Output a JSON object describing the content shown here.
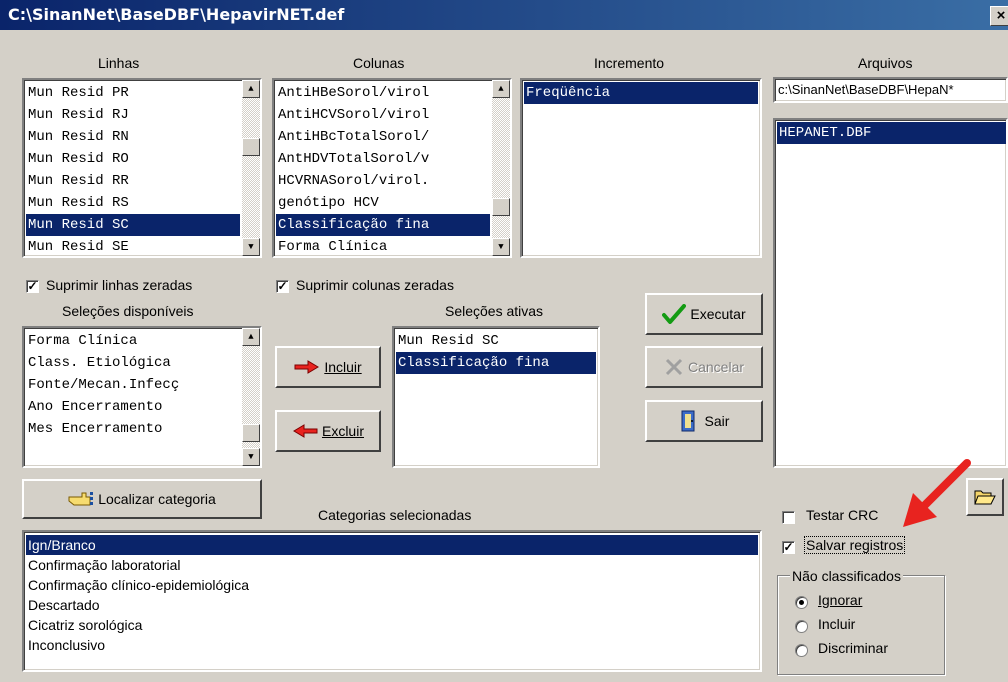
{
  "window": {
    "title": "C:\\SinanNet\\BaseDBF\\HepavirNET.def",
    "close_glyph": "×"
  },
  "labels": {
    "linhas": "Linhas",
    "colunas": "Colunas",
    "incremento": "Incremento",
    "arquivos": "Arquivos",
    "selecoes_disponiveis": "Seleções disponíveis",
    "selecoes_ativas": "Seleções ativas",
    "categorias_selecionadas": "Categorias selecionadas"
  },
  "linhas": {
    "items": [
      "Mun Resid PR",
      "Mun Resid RJ",
      "Mun Resid RN",
      "Mun Resid RO",
      "Mun Resid RR",
      "Mun Resid RS",
      "Mun Resid SC",
      "Mun Resid SE"
    ],
    "selected": "Mun Resid SC"
  },
  "colunas": {
    "items": [
      "AntiHBeSorol/virol",
      "AntiHCVSorol/virol",
      "AntiHBcTotalSorol/",
      "AntHDVTotalSorol/v",
      "HCVRNASorol/virol.",
      "genótipo HCV",
      "Classificação fina",
      "Forma Clínica"
    ],
    "selected": "Classificação fina"
  },
  "incremento": {
    "items": [
      "Freqüência"
    ],
    "selected": "Freqüência"
  },
  "arquivos": {
    "path": "c:\\SinanNet\\BaseDBF\\HepaN*",
    "items": [
      "HEPANET.DBF"
    ],
    "selected": "HEPANET.DBF"
  },
  "checkboxes": {
    "suprimir_linhas": {
      "label": "Suprimir linhas zeradas",
      "checked": true
    },
    "suprimir_colunas": {
      "label": "Suprimir colunas zeradas",
      "checked": true
    },
    "testar_crc": {
      "label": "Testar CRC",
      "checked": false
    },
    "salvar_registros": {
      "label": "Salvar registros",
      "checked": true
    }
  },
  "selecoes_disponiveis": {
    "items": [
      "Forma Clínica",
      "Class. Etiológica",
      "Fonte/Mecan.Infecç",
      "Ano Encerramento",
      "Mes Encerramento"
    ]
  },
  "selecoes_ativas": {
    "items": [
      "Mun Resid SC",
      "Classificação fina"
    ],
    "selected": "Classificação fina"
  },
  "buttons": {
    "incluir": "Incluir",
    "excluir": "Excluir",
    "executar": "Executar",
    "cancelar": "Cancelar",
    "sair": "Sair",
    "localizar": "Localizar categoria"
  },
  "categorias": {
    "items": [
      "Ign/Branco",
      "Confirmação laboratorial",
      "Confirmação clínico-epidemiológica",
      "Descartado",
      "Cicatriz sorológica",
      "Inconclusivo"
    ],
    "selected": "Ign/Branco"
  },
  "nao_classificados": {
    "title": "Não classificados",
    "options": [
      {
        "label": "Ignorar",
        "checked": true
      },
      {
        "label": "Incluir",
        "checked": false
      },
      {
        "label": "Discriminar",
        "checked": false
      }
    ]
  },
  "colors": {
    "selection": "#0a246a",
    "face": "#d4d0c8",
    "arrow_red": "#e8231f"
  },
  "icons": {
    "open_folder": "open-folder-icon",
    "check": "green-check-icon",
    "cancel": "cancel-x-icon",
    "exit": "door-exit-icon",
    "pointer": "hand-pointer-icon",
    "arrow_right": "red-right-arrow-icon",
    "arrow_left": "red-left-arrow-icon"
  }
}
